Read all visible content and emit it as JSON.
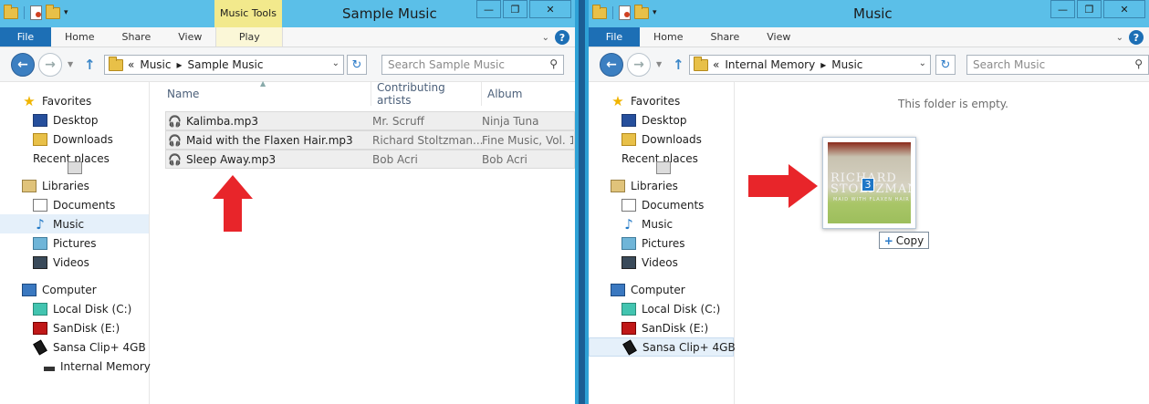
{
  "left_window": {
    "title": "Sample Music",
    "contextual_tab": "Music Tools",
    "ribbon_tabs": [
      "File",
      "Home",
      "Share",
      "View",
      "Play"
    ],
    "address": {
      "prefix": "«",
      "crumbs": [
        "Music",
        "Sample Music"
      ]
    },
    "search_placeholder": "Search Sample Music",
    "nav": {
      "favorites": {
        "label": "Favorites",
        "items": [
          "Desktop",
          "Downloads",
          "Recent places"
        ]
      },
      "libraries": {
        "label": "Libraries",
        "items": [
          "Documents",
          "Music",
          "Pictures",
          "Videos"
        ],
        "selected": "Music"
      },
      "computer": {
        "label": "Computer",
        "items": [
          "Local Disk (C:)",
          "SanDisk (E:)",
          "Sansa Clip+ 4GB"
        ],
        "subitem": "Internal Memory"
      }
    },
    "columns": [
      "Name",
      "Contributing artists",
      "Album"
    ],
    "files": [
      {
        "name": "Kalimba.mp3",
        "artist": "Mr. Scruff",
        "album": "Ninja Tuna"
      },
      {
        "name": "Maid with the Flaxen Hair.mp3",
        "artist": "Richard Stoltzman...",
        "album": "Fine Music, Vol. 1"
      },
      {
        "name": "Sleep Away.mp3",
        "artist": "Bob Acri",
        "album": "Bob Acri"
      }
    ]
  },
  "right_window": {
    "title": "Music",
    "ribbon_tabs": [
      "File",
      "Home",
      "Share",
      "View"
    ],
    "address": {
      "prefix": "«",
      "crumbs": [
        "Internal Memory",
        "Music"
      ]
    },
    "search_placeholder": "Search Music",
    "nav": {
      "favorites": {
        "label": "Favorites",
        "items": [
          "Desktop",
          "Downloads",
          "Recent places"
        ]
      },
      "libraries": {
        "label": "Libraries",
        "items": [
          "Documents",
          "Music",
          "Pictures",
          "Videos"
        ]
      },
      "computer": {
        "label": "Computer",
        "items": [
          "Local Disk (C:)",
          "SanDisk (E:)",
          "Sansa Clip+ 4GB"
        ],
        "selected": "Sansa Clip+ 4GB"
      }
    },
    "empty_message": "This folder is empty.",
    "drag": {
      "count": "3",
      "action": "Copy",
      "art_title": "RICHARD STOLTZMAN",
      "art_subtitle": "MAID WITH FLAXEN HAIR"
    }
  },
  "colors": {
    "title_bar": "#5bbfe8",
    "file_tab": "#1d6fb5",
    "contextual_tab": "#f2e98c",
    "arrow": "#e8252a",
    "selected_nav": "#e5f0fa"
  }
}
